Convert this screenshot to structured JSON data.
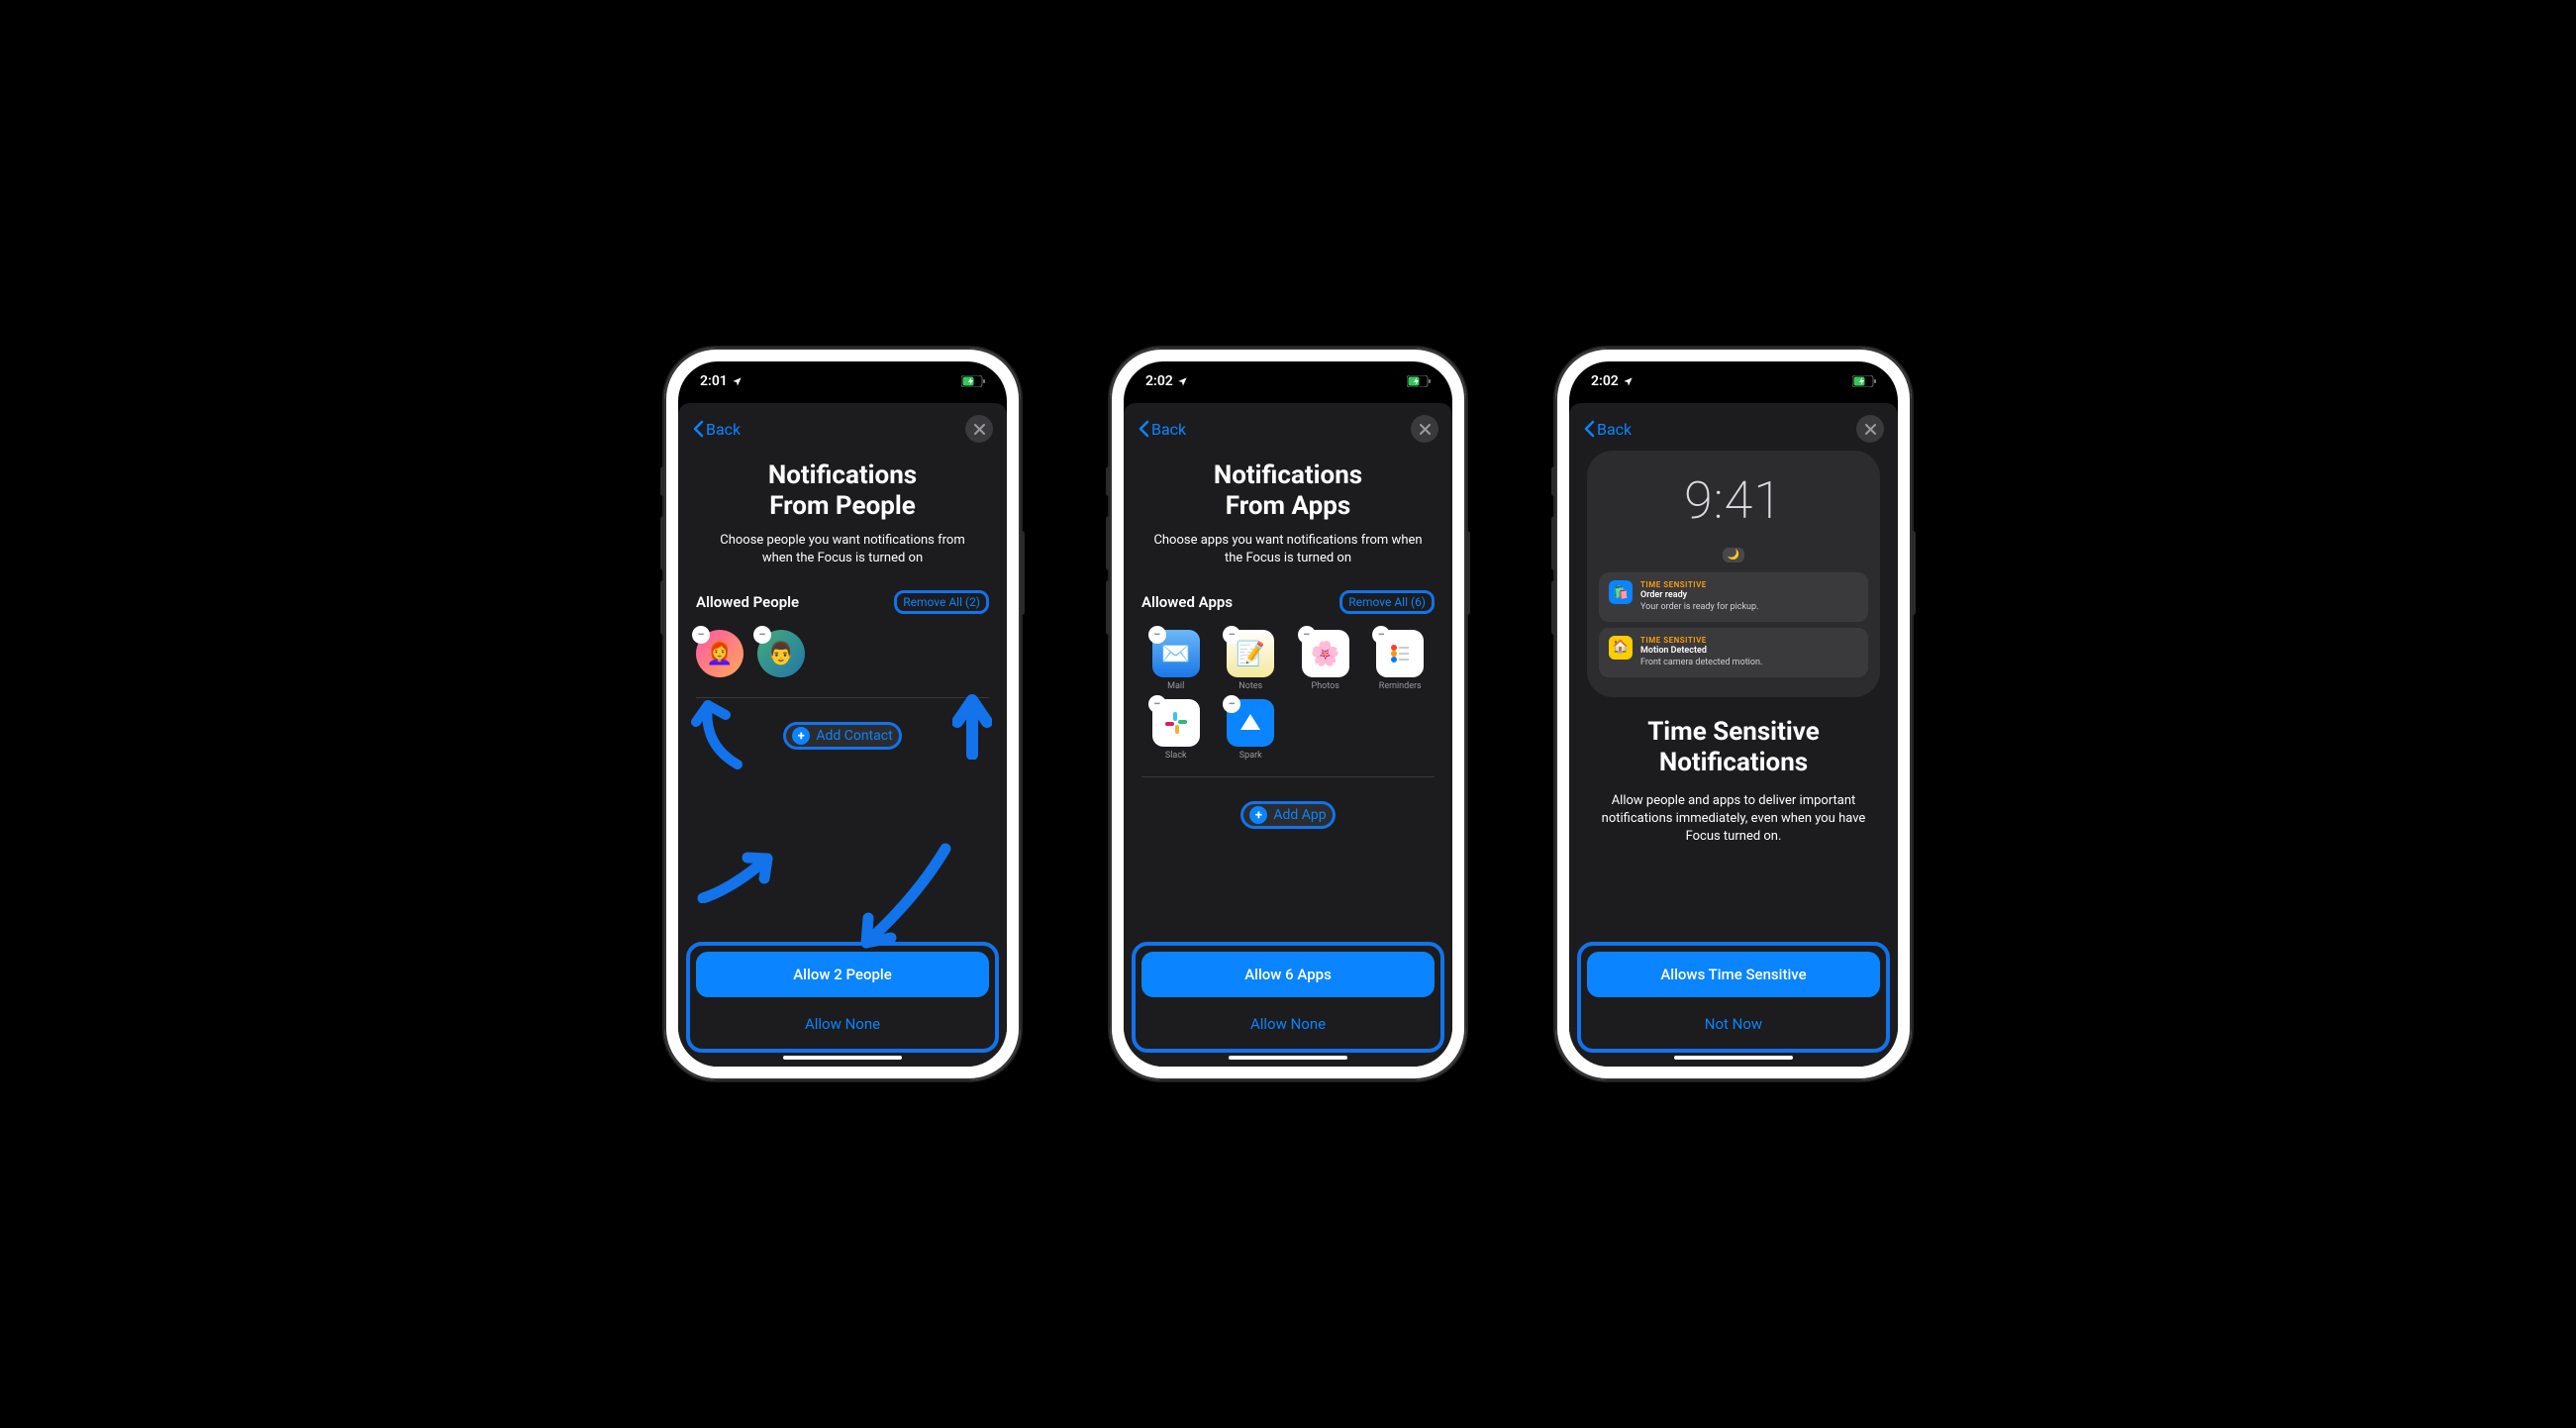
{
  "screens": [
    {
      "status": {
        "time": "2:01"
      },
      "back": "Back",
      "title": "Notifications\nFrom People",
      "subtitle": "Choose people you want notifications from when the Focus is turned on",
      "section_label": "Allowed People",
      "remove_all": "Remove All (2)",
      "add_label": "Add Contact",
      "primary": "Allow 2 People",
      "secondary": "Allow None"
    },
    {
      "status": {
        "time": "2:02"
      },
      "back": "Back",
      "title": "Notifications\nFrom Apps",
      "subtitle": "Choose apps you want notifications from when the Focus is turned on",
      "section_label": "Allowed Apps",
      "remove_all": "Remove All (6)",
      "apps": [
        {
          "label": "Mail"
        },
        {
          "label": "Notes"
        },
        {
          "label": "Photos"
        },
        {
          "label": "Reminders"
        },
        {
          "label": "Slack"
        },
        {
          "label": "Spark"
        }
      ],
      "add_label": "Add App",
      "primary": "Allow 6 Apps",
      "secondary": "Allow None"
    },
    {
      "status": {
        "time": "2:02"
      },
      "back": "Back",
      "preview": {
        "time": "9:41",
        "noti1": {
          "tag": "TIME SENSITIVE",
          "title": "Order ready",
          "text": "Your order is ready for pickup."
        },
        "noti2": {
          "tag": "TIME SENSITIVE",
          "title": "Motion Detected",
          "text": "Front camera detected motion."
        }
      },
      "ts_title": "Time Sensitive\nNotifications",
      "ts_sub": "Allow people and apps to deliver important notifications immediately, even when you have Focus turned on.",
      "primary": "Allows Time Sensitive",
      "secondary": "Not Now"
    }
  ]
}
